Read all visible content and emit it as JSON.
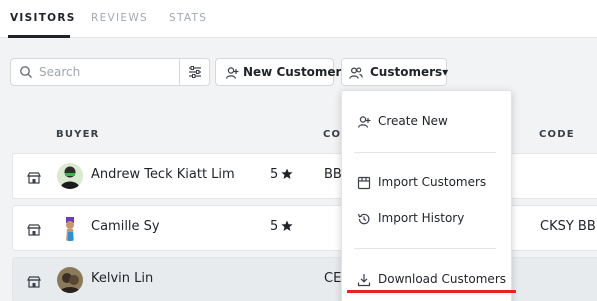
{
  "tabs": [
    {
      "label": "VISITORS",
      "active": true
    },
    {
      "label": "REVIEWS",
      "active": false
    },
    {
      "label": "STATS",
      "active": false
    }
  ],
  "toolbar": {
    "search_placeholder": "Search",
    "new_customer_label": "New Customer",
    "customers_label": "Customers▾"
  },
  "table": {
    "columns": [
      "BUYER",
      "CO",
      "CODE"
    ],
    "rows": [
      {
        "name": "Andrew Teck Kiatt Lim",
        "rating": "5",
        "company": "BB",
        "code": ""
      },
      {
        "name": "Camille Sy",
        "rating": "5",
        "company": "",
        "code": "CKSY BB"
      },
      {
        "name": "Kelvin Lin",
        "rating": "",
        "company": "CE",
        "code": ""
      }
    ]
  },
  "dropdown": {
    "items": [
      "Create New",
      "Import Customers",
      "Import History",
      "Download Customers"
    ]
  },
  "colors": {
    "accent_underline": "#1f2328",
    "highlight_red": "#e1261c",
    "page_bg": "#f1f3f4"
  }
}
